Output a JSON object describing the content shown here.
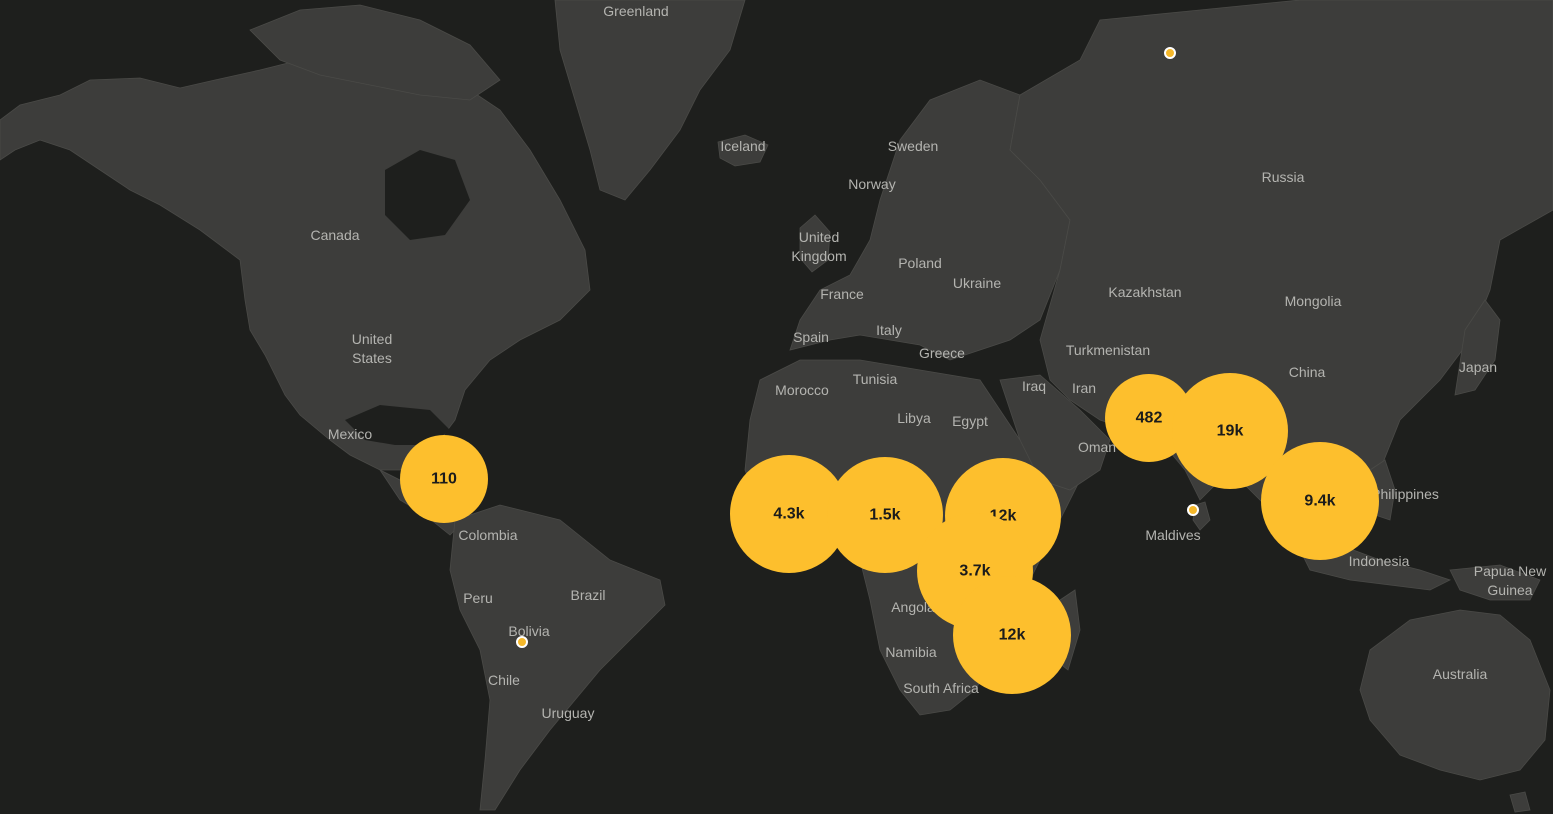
{
  "map": {
    "theme": {
      "background": "#1e1f1d",
      "land": "#3d3d3b",
      "marker": "#fdbf2d",
      "label": "#b4b4b0"
    },
    "country_labels": [
      {
        "id": "greenland",
        "lines": [
          "Greenland"
        ]
      },
      {
        "id": "iceland",
        "lines": [
          "Iceland"
        ]
      },
      {
        "id": "sweden",
        "lines": [
          "Sweden"
        ]
      },
      {
        "id": "norway",
        "lines": [
          "Norway"
        ]
      },
      {
        "id": "russia",
        "lines": [
          "Russia"
        ]
      },
      {
        "id": "canada",
        "lines": [
          "Canada"
        ]
      },
      {
        "id": "united-kingdom",
        "lines": [
          "United",
          "Kingdom"
        ]
      },
      {
        "id": "poland",
        "lines": [
          "Poland"
        ]
      },
      {
        "id": "ukraine",
        "lines": [
          "Ukraine"
        ]
      },
      {
        "id": "kazakhstan",
        "lines": [
          "Kazakhstan"
        ]
      },
      {
        "id": "mongolia",
        "lines": [
          "Mongolia"
        ]
      },
      {
        "id": "france",
        "lines": [
          "France"
        ]
      },
      {
        "id": "united-states",
        "lines": [
          "United",
          "States"
        ]
      },
      {
        "id": "italy",
        "lines": [
          "Italy"
        ]
      },
      {
        "id": "spain",
        "lines": [
          "Spain"
        ]
      },
      {
        "id": "greece",
        "lines": [
          "Greece"
        ]
      },
      {
        "id": "turkmenistan",
        "lines": [
          "Turkmenistan"
        ]
      },
      {
        "id": "china",
        "lines": [
          "China"
        ]
      },
      {
        "id": "japan",
        "lines": [
          "Japan"
        ]
      },
      {
        "id": "tunisia",
        "lines": [
          "Tunisia"
        ]
      },
      {
        "id": "morocco",
        "lines": [
          "Morocco"
        ]
      },
      {
        "id": "iraq",
        "lines": [
          "Iraq"
        ]
      },
      {
        "id": "iran",
        "lines": [
          "Iran"
        ]
      },
      {
        "id": "mexico",
        "lines": [
          "Mexico"
        ]
      },
      {
        "id": "libya",
        "lines": [
          "Libya"
        ]
      },
      {
        "id": "egypt",
        "lines": [
          "Egypt"
        ]
      },
      {
        "id": "oman",
        "lines": [
          "Oman"
        ]
      },
      {
        "id": "philippines",
        "lines": [
          "Philippines"
        ]
      },
      {
        "id": "colombia",
        "lines": [
          "Colombia"
        ]
      },
      {
        "id": "maldives",
        "lines": [
          "Maldives"
        ]
      },
      {
        "id": "indonesia",
        "lines": [
          "Indonesia"
        ]
      },
      {
        "id": "papua-new-guinea",
        "lines": [
          "Papua New",
          "Guinea"
        ]
      },
      {
        "id": "brazil",
        "lines": [
          "Brazil"
        ]
      },
      {
        "id": "peru",
        "lines": [
          "Peru"
        ]
      },
      {
        "id": "angola",
        "lines": [
          "Angola"
        ]
      },
      {
        "id": "bolivia",
        "lines": [
          "Bolivia"
        ]
      },
      {
        "id": "namibia",
        "lines": [
          "Namibia"
        ]
      },
      {
        "id": "chile",
        "lines": [
          "Chile"
        ]
      },
      {
        "id": "australia",
        "lines": [
          "Australia"
        ]
      },
      {
        "id": "south-africa",
        "lines": [
          "South Africa"
        ]
      },
      {
        "id": "uruguay",
        "lines": [
          "Uruguay"
        ]
      }
    ],
    "clusters": [
      {
        "id": "central-america",
        "count": "110"
      },
      {
        "id": "west-africa",
        "count": "4.3k"
      },
      {
        "id": "central-africa",
        "count": "1.5k"
      },
      {
        "id": "east-africa",
        "count": "12k"
      },
      {
        "id": "southern-central-africa",
        "count": "3.7k"
      },
      {
        "id": "southeast-africa",
        "count": "12k"
      },
      {
        "id": "pakistan-region",
        "count": "482"
      },
      {
        "id": "india-region",
        "count": "19k"
      },
      {
        "id": "southeast-asia",
        "count": "9.4k"
      }
    ],
    "points": [
      {
        "id": "northwest-russia"
      },
      {
        "id": "sri-lanka"
      },
      {
        "id": "bolivia"
      }
    ]
  }
}
